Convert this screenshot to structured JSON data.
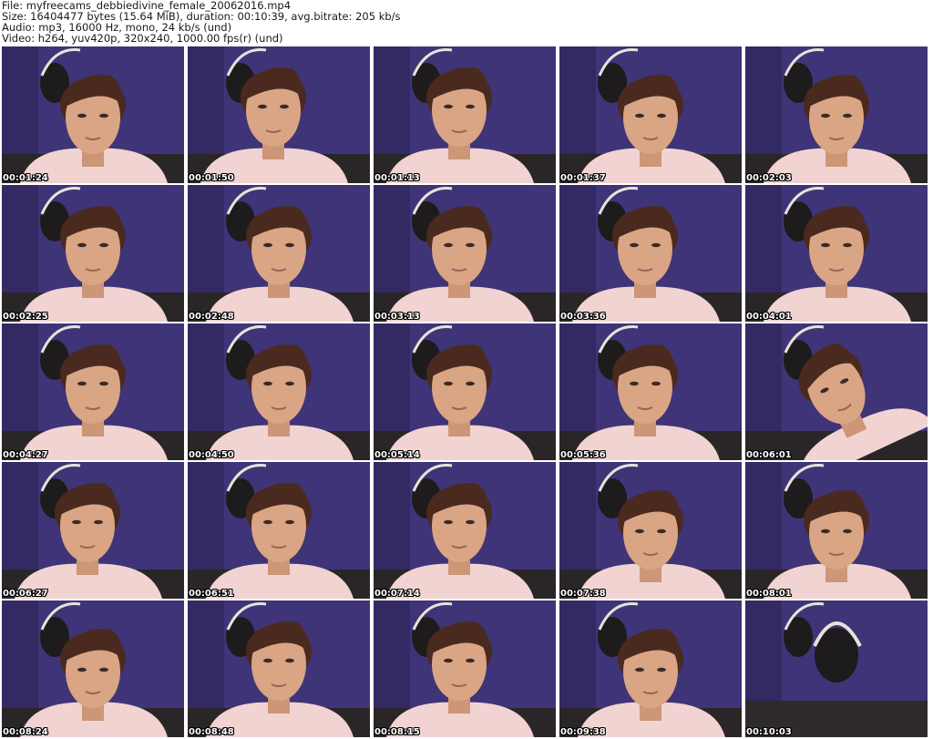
{
  "header": {
    "file_line": "File: myfreecams_debbiedivine_female_20062016.mp4",
    "size_line": "Size: 16404477 bytes (15.64 MiB), duration: 00:10:39, avg.bitrate: 205 kb/s",
    "audio_line": "Audio: mp3, 16000 Hz, mono, 24 kb/s (und)",
    "video_line": "Video: h264, yuv420p, 320x240, 1000.00 fps(r) (und)"
  },
  "colors": {
    "wall": "#3f3477",
    "wall_shadow": "#2c2456",
    "skin": "#d9a584",
    "hair": "#4a2a1e",
    "shirt": "#f1d3d2",
    "headphones": "#1d1b1c",
    "timestamp_text": "#ffffff"
  },
  "thumbnails": [
    {
      "time": "00:01:24",
      "scene": "person-looking-down"
    },
    {
      "time": "00:01:50",
      "scene": "person-looking-side"
    },
    {
      "time": "00:01:13",
      "scene": "person-looking-side"
    },
    {
      "time": "00:01:37",
      "scene": "person-looking-down"
    },
    {
      "time": "00:02:03",
      "scene": "person-looking-down"
    },
    {
      "time": "00:02:25",
      "scene": "person-facing"
    },
    {
      "time": "00:02:48",
      "scene": "person-facing"
    },
    {
      "time": "00:03:13",
      "scene": "person-looking-side"
    },
    {
      "time": "00:03:36",
      "scene": "person-looking-side"
    },
    {
      "time": "00:04:01",
      "scene": "person-facing"
    },
    {
      "time": "00:04:27",
      "scene": "person-facing"
    },
    {
      "time": "00:04:50",
      "scene": "person-facing"
    },
    {
      "time": "00:05:14",
      "scene": "person-looking-side"
    },
    {
      "time": "00:05:36",
      "scene": "person-looking-side"
    },
    {
      "time": "00:06:01",
      "scene": "person-tilted"
    },
    {
      "time": "00:06:27",
      "scene": "person-looking-side"
    },
    {
      "time": "00:06:51",
      "scene": "person-facing"
    },
    {
      "time": "00:07:14",
      "scene": "person-looking-side"
    },
    {
      "time": "00:07:38",
      "scene": "person-looking-down"
    },
    {
      "time": "00:08:01",
      "scene": "person-looking-down"
    },
    {
      "time": "00:08:24",
      "scene": "person-looking-down"
    },
    {
      "time": "00:08:48",
      "scene": "person-facing"
    },
    {
      "time": "00:08:15",
      "scene": "person-looking-side"
    },
    {
      "time": "00:09:38",
      "scene": "person-looking-down"
    },
    {
      "time": "00:10:03",
      "scene": "empty-chair"
    }
  ]
}
